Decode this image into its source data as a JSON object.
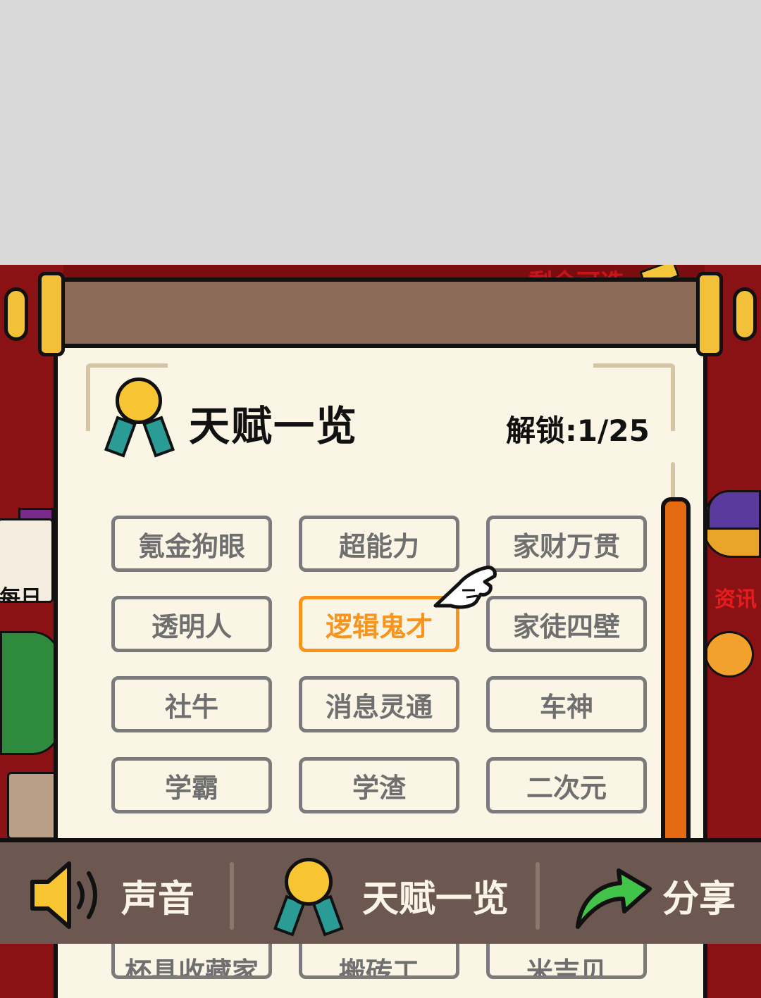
{
  "background_text": {
    "remaining": "剩余可选",
    "daily": "每日",
    "news": "资讯"
  },
  "panel": {
    "title": "天赋一览",
    "unlock_text": "解锁:1/25"
  },
  "talents": [
    {
      "label": "氪金狗眼",
      "active": false
    },
    {
      "label": "超能力",
      "active": false
    },
    {
      "label": "家财万贯",
      "active": false
    },
    {
      "label": "透明人",
      "active": false
    },
    {
      "label": "逻辑鬼才",
      "active": true
    },
    {
      "label": "家徒四壁",
      "active": false
    },
    {
      "label": "社牛",
      "active": false
    },
    {
      "label": "消息灵通",
      "active": false
    },
    {
      "label": "车神",
      "active": false
    },
    {
      "label": "学霸",
      "active": false
    },
    {
      "label": "学渣",
      "active": false
    },
    {
      "label": "二次元",
      "active": false
    }
  ],
  "talents_partial": [
    "杯具收藏家",
    "搬砖工",
    "米吉贝"
  ],
  "toolbar": {
    "sound": "声音",
    "talents": "天赋一览",
    "share": "分享"
  },
  "colors": {
    "accent_orange": "#f7941d",
    "paper": "#fbf5e6",
    "toolbar": "#6c5850",
    "medal_gold": "#f6c531",
    "ribbon_teal": "#2a9b95"
  },
  "icons": [
    "medal-icon",
    "speaker-icon",
    "share-arrow-icon",
    "pointing-hand-icon"
  ]
}
